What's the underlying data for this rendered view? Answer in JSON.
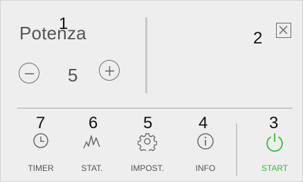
{
  "panel": {
    "title": "Potenza",
    "value": "5",
    "callouts": [
      "1",
      "2",
      "3",
      "4",
      "5",
      "6",
      "7"
    ]
  },
  "toolbar": {
    "items": [
      {
        "label": "TIMER",
        "icon": "timer-icon"
      },
      {
        "label": "STAT.",
        "icon": "stats-icon"
      },
      {
        "label": "IMPOST.",
        "icon": "gear-icon"
      },
      {
        "label": "INFO",
        "icon": "info-icon"
      },
      {
        "label": "START",
        "icon": "power-icon"
      }
    ]
  },
  "colors": {
    "background": "#eeeeee",
    "icon": "#6a6a6a",
    "divider": "#c8c8c8",
    "start": "#2fbf2f"
  }
}
